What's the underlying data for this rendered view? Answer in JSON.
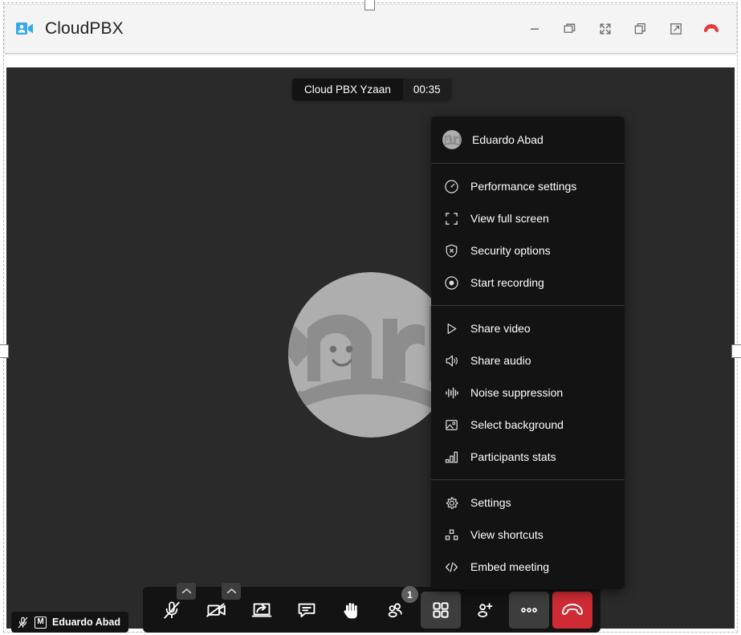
{
  "window": {
    "app_icon": "video-contact-icon",
    "title": "CloudPBX",
    "controls": [
      {
        "name": "minimize",
        "icon": "minimize-icon"
      },
      {
        "name": "restore",
        "icon": "restore-window-icon"
      },
      {
        "name": "fullscreen",
        "icon": "expand-fullscreen-icon"
      },
      {
        "name": "duplicate",
        "icon": "copy-icon"
      },
      {
        "name": "pop-out",
        "icon": "external-link-icon"
      },
      {
        "name": "hangup",
        "icon": "phone-hangup-icon",
        "color": "#e03b3b"
      }
    ]
  },
  "stage": {
    "subject": "Cloud PBX Yzaan",
    "timer": "00:35",
    "background_color": "#2a2a2a",
    "avatar_alt": "arl"
  },
  "menu": {
    "header": {
      "name": "Eduardo Abad",
      "avatar_alt": "arl"
    },
    "groups": [
      {
        "items": [
          {
            "label": "Performance settings",
            "icon": "gauge-icon"
          },
          {
            "label": "View full screen",
            "icon": "fullscreen-corners-icon"
          },
          {
            "label": "Security options",
            "icon": "shield-lock-icon"
          },
          {
            "label": "Start recording",
            "icon": "record-dot-icon"
          }
        ]
      },
      {
        "items": [
          {
            "label": "Share video",
            "icon": "play-triangle-icon"
          },
          {
            "label": "Share audio",
            "icon": "speaker-icon"
          },
          {
            "label": "Noise suppression",
            "icon": "waveform-icon"
          },
          {
            "label": "Select background",
            "icon": "image-icon"
          },
          {
            "label": "Participants stats",
            "icon": "bar-chart-icon"
          }
        ]
      },
      {
        "items": [
          {
            "label": "Settings",
            "icon": "gear-icon"
          },
          {
            "label": "View shortcuts",
            "icon": "keyboard-shortcuts-icon"
          },
          {
            "label": "Embed meeting",
            "icon": "code-brackets-icon"
          }
        ]
      }
    ]
  },
  "toolbar": {
    "buttons": [
      {
        "name": "microphone-toggle",
        "icon": "mic-muted-icon",
        "chevron": true,
        "state": "muted"
      },
      {
        "name": "camera-toggle",
        "icon": "camera-muted-icon",
        "chevron": true,
        "state": "muted"
      },
      {
        "name": "screen-share",
        "icon": "screen-share-icon",
        "chevron": false
      },
      {
        "name": "chat",
        "icon": "chat-bubble-icon",
        "chevron": false
      },
      {
        "name": "raise-hand",
        "icon": "raised-hand-icon",
        "chevron": true
      },
      {
        "name": "participants",
        "icon": "participants-icon",
        "chevron": false,
        "badge": "1"
      },
      {
        "name": "tile-view",
        "icon": "grid-tiles-icon",
        "chevron": false,
        "highlight": true
      },
      {
        "name": "invite-people",
        "icon": "person-add-icon",
        "chevron": false
      },
      {
        "name": "more-options",
        "icon": "three-dots-icon",
        "chevron": false,
        "highlight": true
      },
      {
        "name": "leave-meeting",
        "icon": "phone-hangup-icon",
        "chevron": false,
        "danger": true
      }
    ]
  },
  "local_participant": {
    "mic_icon": "mic-muted-icon",
    "moderator_badge": "M",
    "name": "Eduardo Abad"
  },
  "colors": {
    "titlebar_bg": "#f4f4f4",
    "stage_bg": "#2a2a2a",
    "menu_bg": "#131313",
    "toolbar_bg": "#131313",
    "danger": "#ce2b34",
    "accent_blue": "#34abe8"
  }
}
